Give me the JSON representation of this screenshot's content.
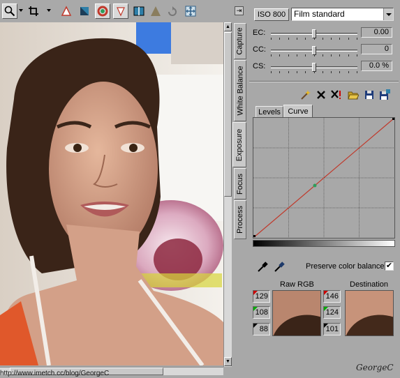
{
  "toolbar": {
    "tools": [
      "zoom-tool",
      "crop-tool",
      "highlight-warning",
      "shadow-warning",
      "color-picker",
      "white-balance-picker",
      "split-view",
      "straighten",
      "rotate",
      "fit-screen"
    ]
  },
  "photo": {
    "status_url": "http://www.imetch.cc/blog/GeorgeC"
  },
  "vertical_tabs": [
    "Capture",
    "White Balance",
    "Exposure",
    "Focus",
    "Process"
  ],
  "panel": {
    "iso_label": "ISO 800",
    "film_mode": "Film standard",
    "sliders": [
      {
        "label": "EC:",
        "value": "0.00",
        "level": 0.5
      },
      {
        "label": "CC:",
        "value": "0",
        "level": 0.5
      },
      {
        "label": "CS:",
        "value": "0.0 %",
        "level": 0.5
      }
    ],
    "tabs": [
      "Levels",
      "Curve"
    ],
    "active_tab": "Curve",
    "preserve_label": "Preserve color balance",
    "preserve_checked": "✔",
    "raw_rgb_label": "Raw RGB",
    "destination_label": "Destination",
    "raw_rgb": [
      "129",
      "108",
      "88"
    ],
    "destination_rgb": [
      "146",
      "124",
      "101"
    ],
    "signature": "GeorgeC"
  },
  "colors": {
    "curve_line": "#c0392b",
    "curve_point": "#2e9d5a"
  }
}
